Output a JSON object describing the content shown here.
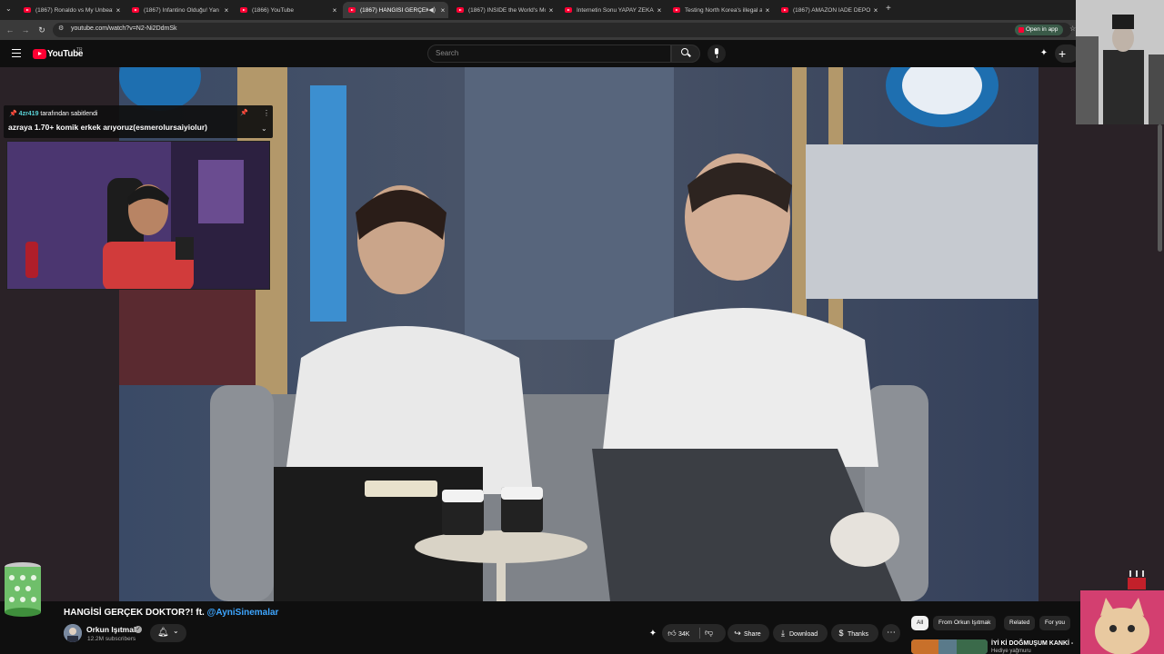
{
  "browser": {
    "tabs": [
      {
        "title": "(1867) Ronaldo vs My Unbeate",
        "active": false
      },
      {
        "title": "(1867) Infantino Olduğu! Yan Yan",
        "active": false
      },
      {
        "title": "(1866) YouTube",
        "active": false
      },
      {
        "title": "(1867) HANGİSİ GERÇEK D",
        "active": true
      },
      {
        "title": "(1867) INSIDE the World's Mor",
        "active": false
      },
      {
        "title": "İnternetin Sonu YAPAY ZEKA O",
        "active": false
      },
      {
        "title": "Testing North Korea's illegal ar",
        "active": false
      },
      {
        "title": "(1867) AMAZON İADE DEPOSU",
        "active": false
      }
    ],
    "new_tab_label": "+",
    "url": "youtube.com/watch?v=N2-Ni2DdmSk",
    "open_in_app": "Open in app"
  },
  "youtube": {
    "logo_text": "YouTube",
    "region": "TR",
    "search_placeholder": "Search"
  },
  "overlay": {
    "pin_user": "4zr419",
    "pin_suffix": " tarafından sabitlendi",
    "pin_message": "azraya 1.70+ komik erkek arıyoruz(esmerolursaiyiolur)"
  },
  "video": {
    "title_prefix": "HANGİSİ GERÇEK DOKTOR?! ft. ",
    "title_mention": "@AyniSinemalar",
    "channel": "Orkun Işıtmak",
    "subscribers": "12.2M subscribers",
    "likes": "34K",
    "share": "Share",
    "download": "Download",
    "thanks": "Thanks"
  },
  "filters": [
    "All",
    "From Orkun Işıtmak",
    "Related",
    "For you"
  ],
  "recommendation": {
    "title": "İYİ Kİ DOĞMUŞUM KANKİ -",
    "subtitle": "Hediye yağmuru"
  },
  "colors": {
    "accent": "#ff0033",
    "mention": "#3ea6ff",
    "pin_user": "#5ad3d7"
  }
}
